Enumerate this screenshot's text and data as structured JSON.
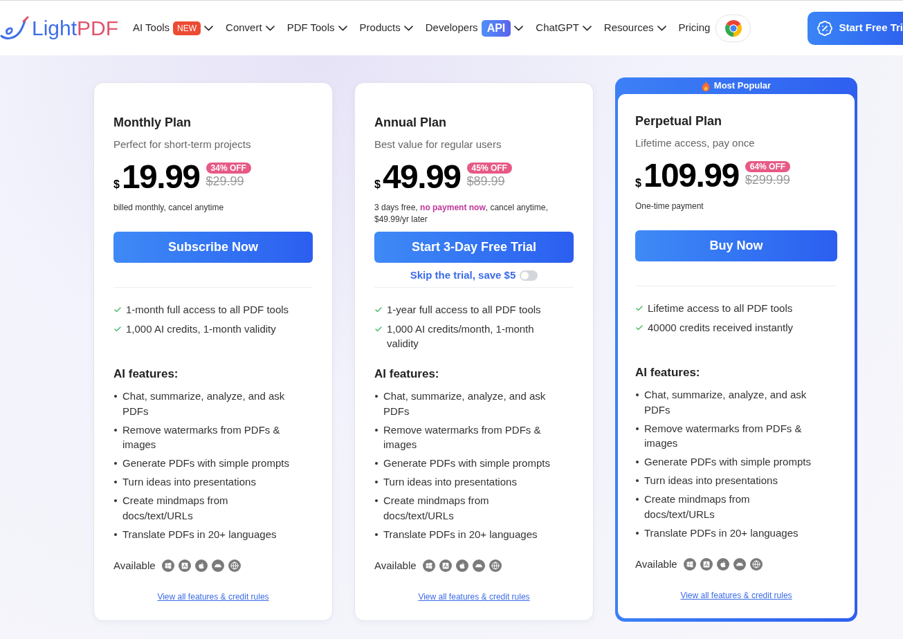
{
  "header": {
    "logo": [
      {
        "text": "Light",
        "color": "#3d6de8"
      },
      {
        "text": "PDF",
        "color": "#e0536d"
      }
    ],
    "nav": [
      {
        "label": "AI Tools",
        "badge": {
          "text": "NEW",
          "kind": "new"
        },
        "dropdown": true
      },
      {
        "label": "Convert",
        "dropdown": true
      },
      {
        "label": "PDF Tools",
        "dropdown": true
      },
      {
        "label": "Products",
        "dropdown": true
      },
      {
        "label": "Developers",
        "badge": {
          "text": "API",
          "kind": "api"
        },
        "dropdown": true
      },
      {
        "label": "ChatGPT",
        "dropdown": true
      },
      {
        "label": "Resources",
        "dropdown": true
      },
      {
        "label": "Pricing",
        "dropdown": false
      }
    ],
    "cta": "Start Free Tri"
  },
  "plans": [
    {
      "featured": false,
      "title": "Monthly Plan",
      "subtitle": "Perfect for short-term projects",
      "currency": "$",
      "price": "19.99",
      "discount": "34% OFF",
      "original_price": "$29.99",
      "note": [
        {
          "text": "billed monthly, cancel anytime",
          "highlight": false
        }
      ],
      "button": "Subscribe Now",
      "features": [
        "1-month full access to all PDF tools",
        "1,000 AI credits, 1-month validity"
      ],
      "ai_title": "AI features:",
      "ai_features": [
        "Chat, summarize, analyze, and ask PDFs",
        "Remove watermarks from PDFs & images",
        "Generate PDFs with simple prompts",
        "Turn ideas into presentations",
        "Create mindmaps from docs/text/URLs",
        "Translate PDFs in 20+ languages"
      ],
      "available_label": "Available",
      "link": "View all features & credit rules"
    },
    {
      "featured": false,
      "title": "Annual Plan",
      "subtitle": "Best value for regular users",
      "currency": "$",
      "price": "49.99",
      "discount": "45% OFF",
      "original_price": "$89.99",
      "note": [
        {
          "text": "3 days free, ",
          "highlight": false
        },
        {
          "text": "no payment now",
          "highlight": true
        },
        {
          "text": ", cancel anytime, $49.99/yr later",
          "highlight": false
        }
      ],
      "button": "Start 3-Day Free Trial",
      "skip_trial": {
        "label": "Skip the trial, save $5",
        "on": false
      },
      "features": [
        "1-year full access to all PDF tools",
        "1,000 AI credits/month, 1-month validity"
      ],
      "ai_title": "AI features:",
      "ai_features": [
        "Chat, summarize, analyze, and ask PDFs",
        "Remove watermarks from PDFs & images",
        "Generate PDFs with simple prompts",
        "Turn ideas into presentations",
        "Create mindmaps from docs/text/URLs",
        "Translate PDFs in 20+ languages"
      ],
      "available_label": "Available",
      "link": "View all features & credit rules"
    },
    {
      "featured": true,
      "ribbon": "Most Popular",
      "title": "Perpetual Plan",
      "subtitle": "Lifetime access, pay once",
      "currency": "$",
      "price": "109.99",
      "discount": "64% OFF",
      "original_price": "$299.99",
      "note": [
        {
          "text": "One-time payment",
          "highlight": false
        }
      ],
      "button": "Buy Now",
      "features": [
        "Lifetime access to all PDF tools",
        "40000 credits received instantly"
      ],
      "ai_title": "AI features:",
      "ai_features": [
        "Chat, summarize, analyze, and ask PDFs",
        "Remove watermarks from PDFs & images",
        "Generate PDFs with simple prompts",
        "Turn ideas into presentations",
        "Create mindmaps from docs/text/URLs",
        "Translate PDFs in 20+ languages"
      ],
      "available_label": "Available",
      "link": "View all features & credit rules"
    }
  ]
}
